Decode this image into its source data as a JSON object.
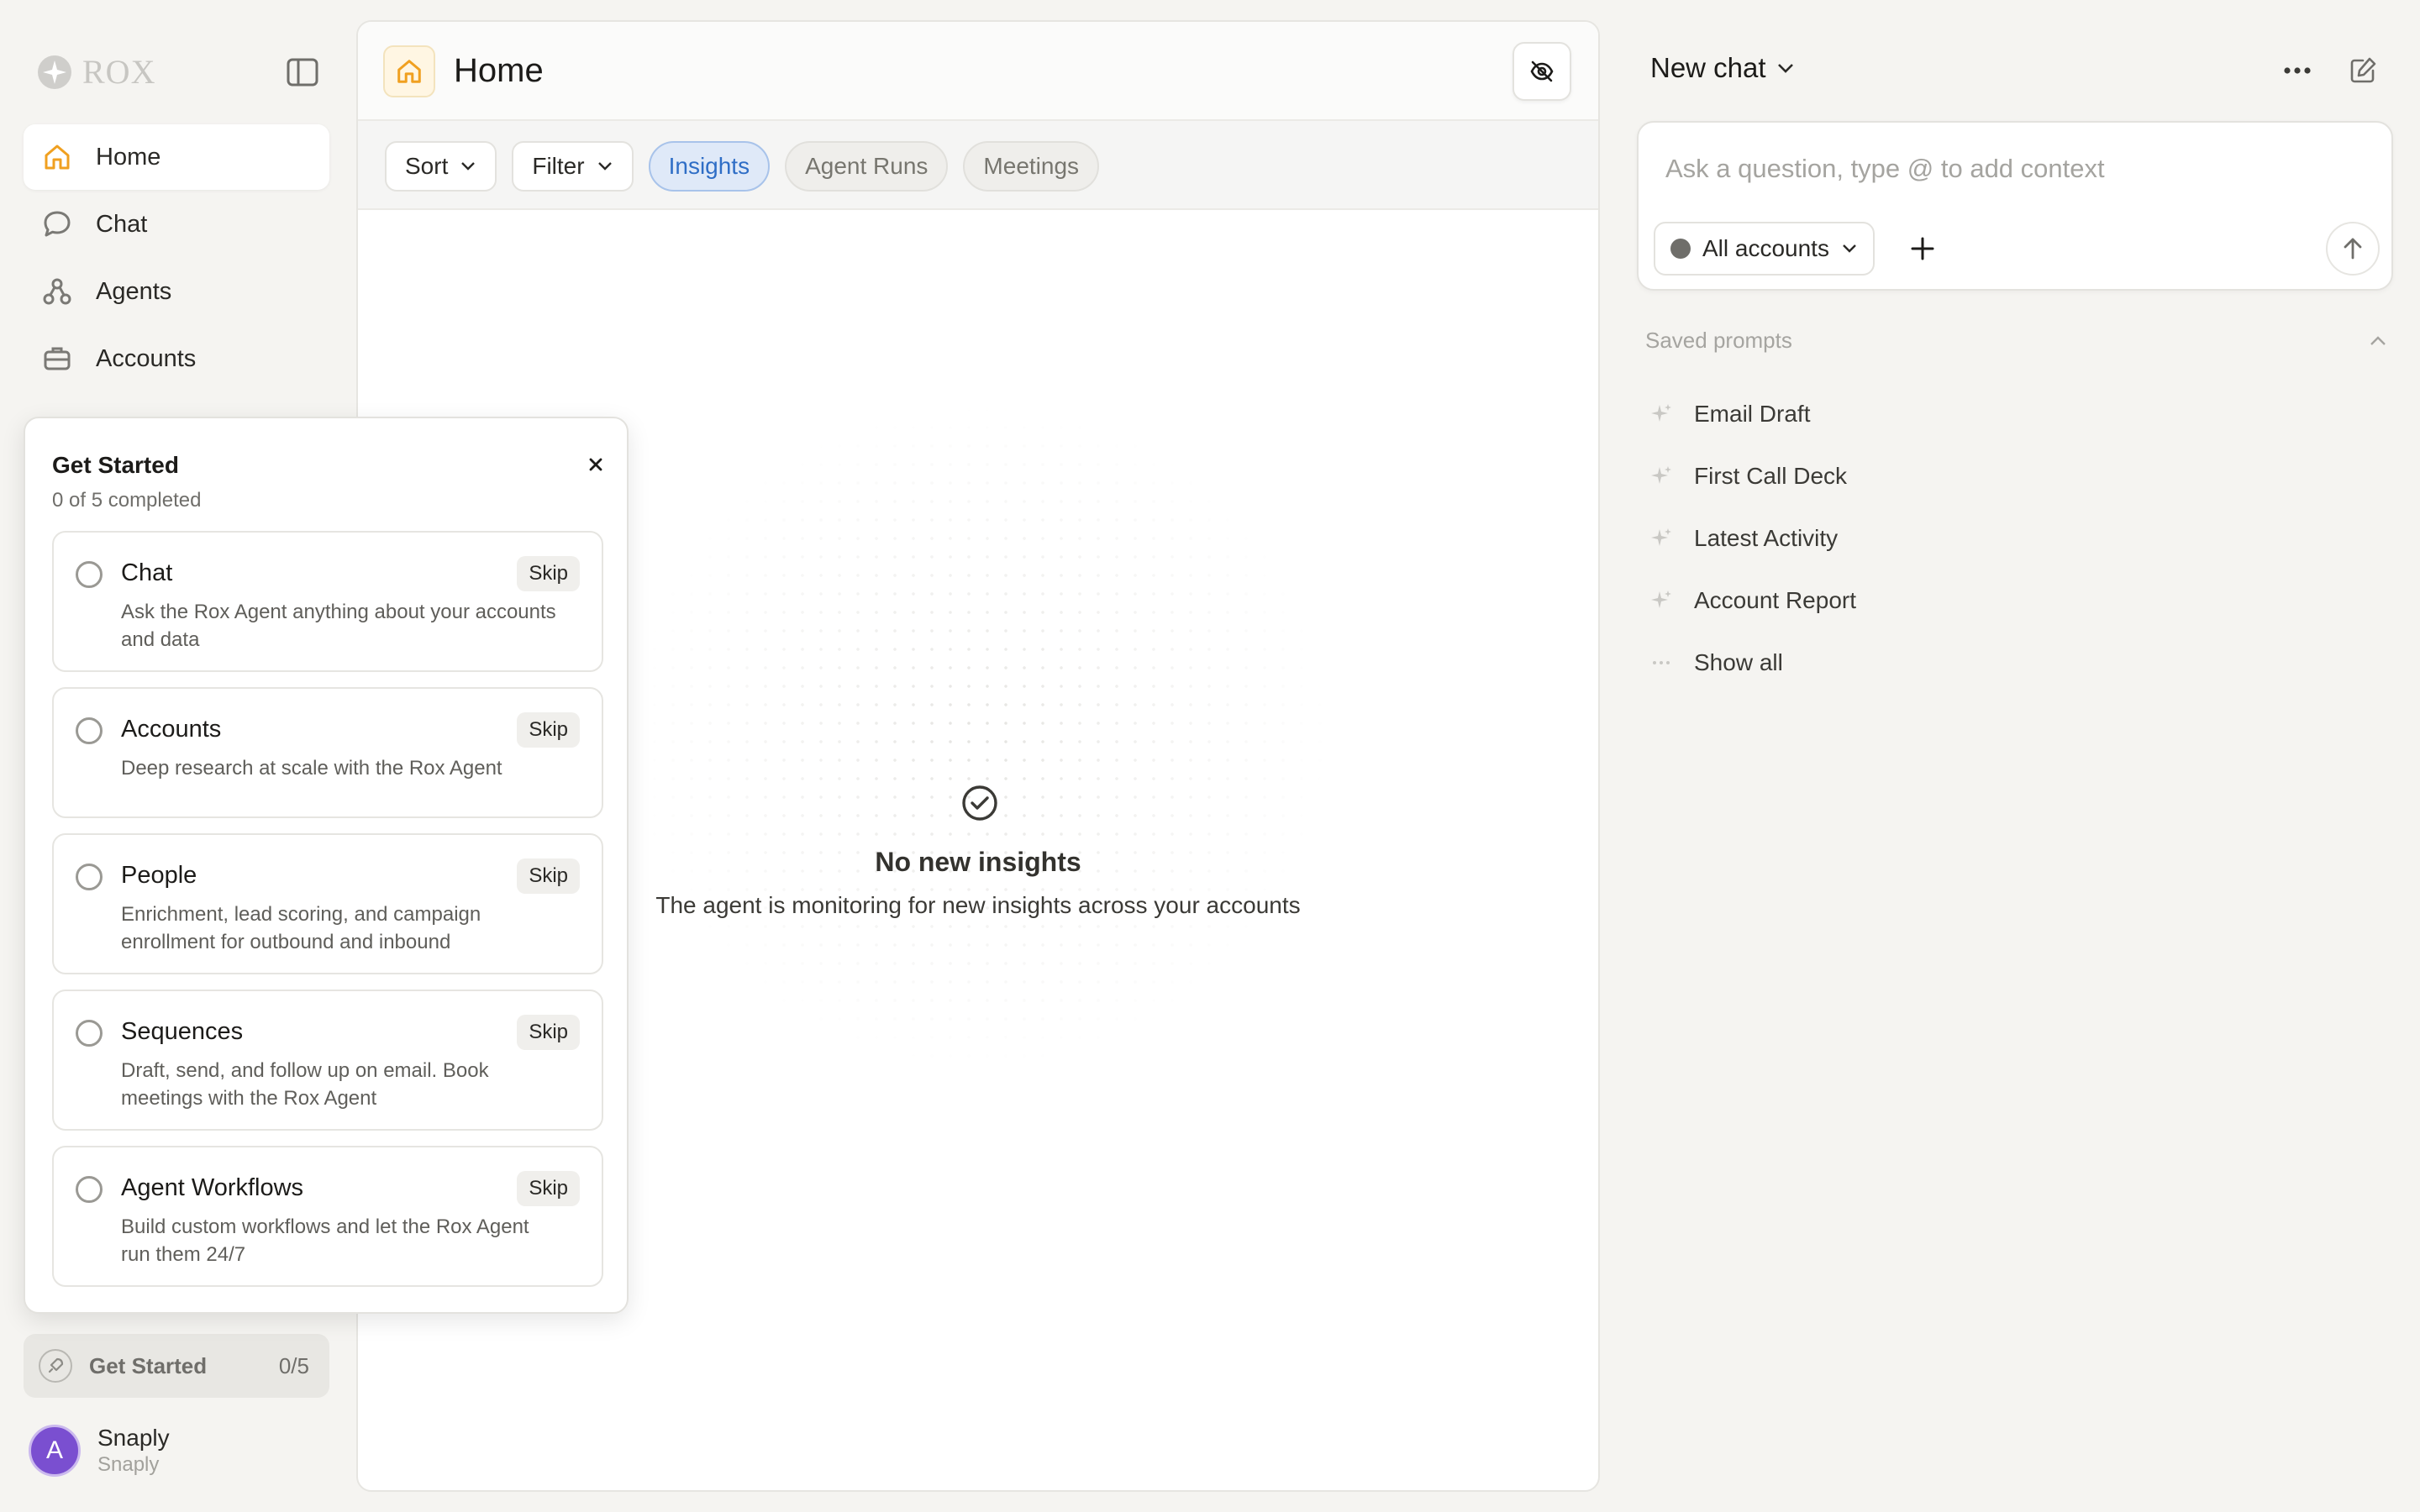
{
  "sidebar": {
    "logo_text": "ROX",
    "nav": [
      {
        "label": "Home",
        "icon": "home-icon",
        "active": true
      },
      {
        "label": "Chat",
        "icon": "chat-bubble-icon"
      },
      {
        "label": "Agents",
        "icon": "agents-icon"
      },
      {
        "label": "Accounts",
        "icon": "briefcase-icon"
      }
    ],
    "get_started": {
      "label": "Get Started",
      "count": "0/5"
    },
    "user": {
      "initial": "A",
      "name": "Snaply",
      "org": "Snaply"
    }
  },
  "main": {
    "title": "Home",
    "toolbar": {
      "sort_label": "Sort",
      "filter_label": "Filter",
      "chips": [
        {
          "label": "Insights",
          "active": true
        },
        {
          "label": "Agent Runs"
        },
        {
          "label": "Meetings"
        }
      ]
    },
    "empty": {
      "title": "No new insights",
      "subtitle": "The agent is monitoring for new insights across your accounts"
    }
  },
  "popover": {
    "title": "Get Started",
    "subtitle": "0 of 5 completed",
    "tasks": [
      {
        "title": "Chat",
        "desc": "Ask the Rox Agent anything about your accounts and data",
        "skip": "Skip"
      },
      {
        "title": "Accounts",
        "desc": "Deep research at scale with the Rox Agent",
        "skip": "Skip"
      },
      {
        "title": "People",
        "desc": "Enrichment, lead scoring, and campaign enrollment for outbound and inbound",
        "skip": "Skip"
      },
      {
        "title": "Sequences",
        "desc": "Draft, send, and follow up on email. Book meetings with the Rox Agent",
        "skip": "Skip"
      },
      {
        "title": "Agent Workflows",
        "desc": "Build custom workflows and let the Rox Agent run them 24/7",
        "skip": "Skip"
      }
    ]
  },
  "chat": {
    "title": "New chat",
    "input_placeholder": "Ask a question, type @ to add context",
    "accounts_label": "All accounts",
    "saved_prompts_label": "Saved prompts",
    "prompts": [
      "Email Draft",
      "First Call Deck",
      "Latest Activity",
      "Account Report"
    ],
    "show_all": "Show all"
  },
  "colors": {
    "accent_home": "#f0a020",
    "active_chip_bg": "#dfe9f8",
    "active_chip_text": "#2f6ec6",
    "avatar": "#7a4fd0"
  }
}
